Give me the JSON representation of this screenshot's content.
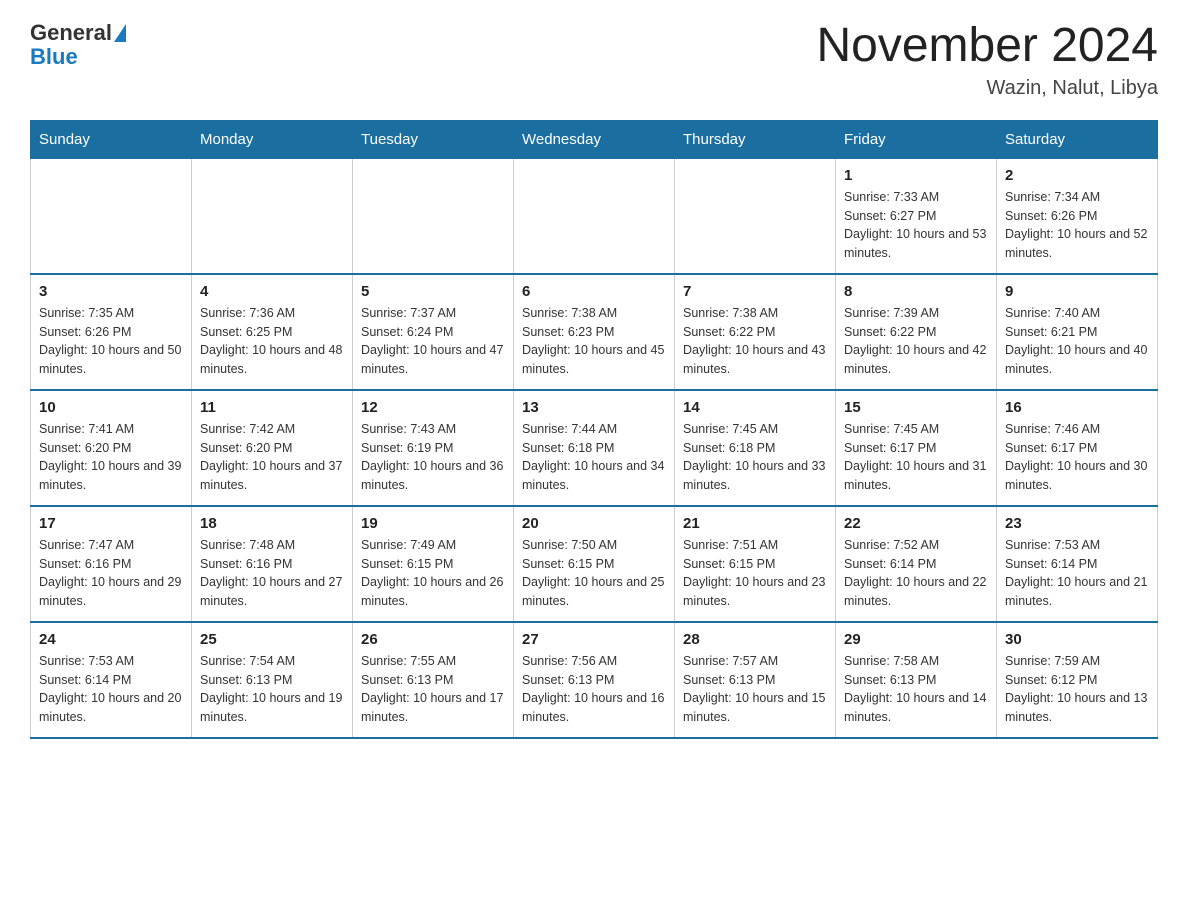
{
  "header": {
    "logo_general": "General",
    "logo_blue": "Blue",
    "month_title": "November 2024",
    "location": "Wazin, Nalut, Libya"
  },
  "weekdays": [
    "Sunday",
    "Monday",
    "Tuesday",
    "Wednesday",
    "Thursday",
    "Friday",
    "Saturday"
  ],
  "weeks": [
    [
      {
        "day": "",
        "info": ""
      },
      {
        "day": "",
        "info": ""
      },
      {
        "day": "",
        "info": ""
      },
      {
        "day": "",
        "info": ""
      },
      {
        "day": "",
        "info": ""
      },
      {
        "day": "1",
        "info": "Sunrise: 7:33 AM\nSunset: 6:27 PM\nDaylight: 10 hours and 53 minutes."
      },
      {
        "day": "2",
        "info": "Sunrise: 7:34 AM\nSunset: 6:26 PM\nDaylight: 10 hours and 52 minutes."
      }
    ],
    [
      {
        "day": "3",
        "info": "Sunrise: 7:35 AM\nSunset: 6:26 PM\nDaylight: 10 hours and 50 minutes."
      },
      {
        "day": "4",
        "info": "Sunrise: 7:36 AM\nSunset: 6:25 PM\nDaylight: 10 hours and 48 minutes."
      },
      {
        "day": "5",
        "info": "Sunrise: 7:37 AM\nSunset: 6:24 PM\nDaylight: 10 hours and 47 minutes."
      },
      {
        "day": "6",
        "info": "Sunrise: 7:38 AM\nSunset: 6:23 PM\nDaylight: 10 hours and 45 minutes."
      },
      {
        "day": "7",
        "info": "Sunrise: 7:38 AM\nSunset: 6:22 PM\nDaylight: 10 hours and 43 minutes."
      },
      {
        "day": "8",
        "info": "Sunrise: 7:39 AM\nSunset: 6:22 PM\nDaylight: 10 hours and 42 minutes."
      },
      {
        "day": "9",
        "info": "Sunrise: 7:40 AM\nSunset: 6:21 PM\nDaylight: 10 hours and 40 minutes."
      }
    ],
    [
      {
        "day": "10",
        "info": "Sunrise: 7:41 AM\nSunset: 6:20 PM\nDaylight: 10 hours and 39 minutes."
      },
      {
        "day": "11",
        "info": "Sunrise: 7:42 AM\nSunset: 6:20 PM\nDaylight: 10 hours and 37 minutes."
      },
      {
        "day": "12",
        "info": "Sunrise: 7:43 AM\nSunset: 6:19 PM\nDaylight: 10 hours and 36 minutes."
      },
      {
        "day": "13",
        "info": "Sunrise: 7:44 AM\nSunset: 6:18 PM\nDaylight: 10 hours and 34 minutes."
      },
      {
        "day": "14",
        "info": "Sunrise: 7:45 AM\nSunset: 6:18 PM\nDaylight: 10 hours and 33 minutes."
      },
      {
        "day": "15",
        "info": "Sunrise: 7:45 AM\nSunset: 6:17 PM\nDaylight: 10 hours and 31 minutes."
      },
      {
        "day": "16",
        "info": "Sunrise: 7:46 AM\nSunset: 6:17 PM\nDaylight: 10 hours and 30 minutes."
      }
    ],
    [
      {
        "day": "17",
        "info": "Sunrise: 7:47 AM\nSunset: 6:16 PM\nDaylight: 10 hours and 29 minutes."
      },
      {
        "day": "18",
        "info": "Sunrise: 7:48 AM\nSunset: 6:16 PM\nDaylight: 10 hours and 27 minutes."
      },
      {
        "day": "19",
        "info": "Sunrise: 7:49 AM\nSunset: 6:15 PM\nDaylight: 10 hours and 26 minutes."
      },
      {
        "day": "20",
        "info": "Sunrise: 7:50 AM\nSunset: 6:15 PM\nDaylight: 10 hours and 25 minutes."
      },
      {
        "day": "21",
        "info": "Sunrise: 7:51 AM\nSunset: 6:15 PM\nDaylight: 10 hours and 23 minutes."
      },
      {
        "day": "22",
        "info": "Sunrise: 7:52 AM\nSunset: 6:14 PM\nDaylight: 10 hours and 22 minutes."
      },
      {
        "day": "23",
        "info": "Sunrise: 7:53 AM\nSunset: 6:14 PM\nDaylight: 10 hours and 21 minutes."
      }
    ],
    [
      {
        "day": "24",
        "info": "Sunrise: 7:53 AM\nSunset: 6:14 PM\nDaylight: 10 hours and 20 minutes."
      },
      {
        "day": "25",
        "info": "Sunrise: 7:54 AM\nSunset: 6:13 PM\nDaylight: 10 hours and 19 minutes."
      },
      {
        "day": "26",
        "info": "Sunrise: 7:55 AM\nSunset: 6:13 PM\nDaylight: 10 hours and 17 minutes."
      },
      {
        "day": "27",
        "info": "Sunrise: 7:56 AM\nSunset: 6:13 PM\nDaylight: 10 hours and 16 minutes."
      },
      {
        "day": "28",
        "info": "Sunrise: 7:57 AM\nSunset: 6:13 PM\nDaylight: 10 hours and 15 minutes."
      },
      {
        "day": "29",
        "info": "Sunrise: 7:58 AM\nSunset: 6:13 PM\nDaylight: 10 hours and 14 minutes."
      },
      {
        "day": "30",
        "info": "Sunrise: 7:59 AM\nSunset: 6:12 PM\nDaylight: 10 hours and 13 minutes."
      }
    ]
  ]
}
